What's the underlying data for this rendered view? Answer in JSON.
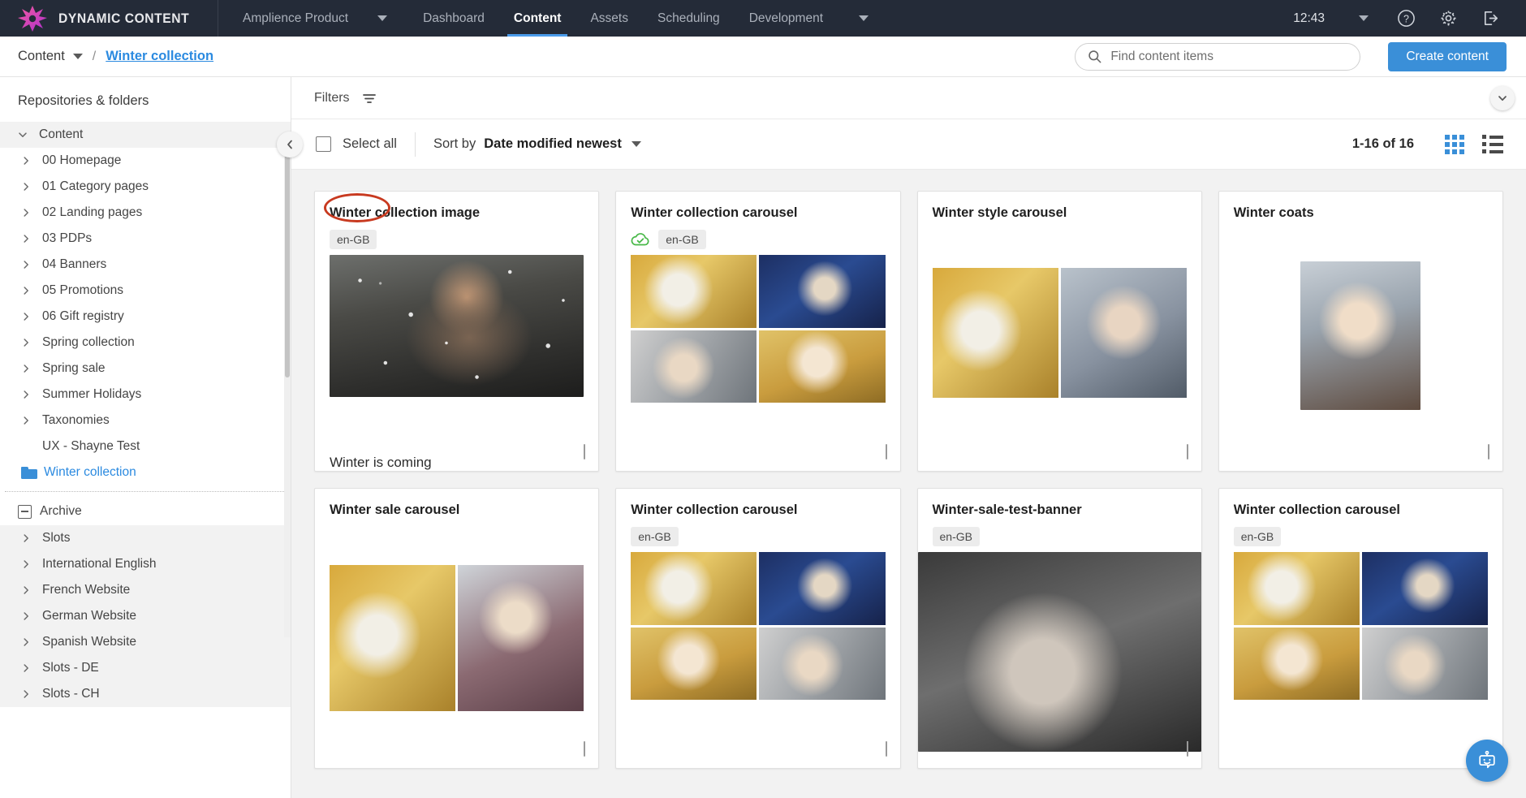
{
  "topnav": {
    "brand": "DYNAMIC CONTENT",
    "product_selector": "Amplience Product",
    "items": [
      {
        "label": "Dashboard",
        "active": false
      },
      {
        "label": "Content",
        "active": true
      },
      {
        "label": "Assets",
        "active": false
      },
      {
        "label": "Scheduling",
        "active": false
      },
      {
        "label": "Development",
        "active": false
      }
    ],
    "clock": "12:43",
    "help_icon": "question-mark-circle-icon",
    "settings_icon": "gear-icon",
    "logout_icon": "sign-out-icon"
  },
  "breadcrumb": {
    "root": "Content",
    "separator": "/",
    "current": "Winter collection"
  },
  "search": {
    "placeholder": "Find content items",
    "value": "",
    "icon": "search-icon"
  },
  "actions": {
    "create_content": "Create content",
    "create_content_color": "#3a8fd8"
  },
  "sidebar": {
    "title": "Repositories & folders",
    "tree": [
      {
        "label": "Content",
        "level": 0,
        "expanded": true,
        "arrow": "chevron-down"
      },
      {
        "label": "00 Homepage",
        "level": 1,
        "arrow": "chevron-right"
      },
      {
        "label": "01 Category pages",
        "level": 1,
        "arrow": "chevron-right"
      },
      {
        "label": "02 Landing pages",
        "level": 1,
        "arrow": "chevron-right"
      },
      {
        "label": "03 PDPs",
        "level": 1,
        "arrow": "chevron-right"
      },
      {
        "label": "04 Banners",
        "level": 1,
        "arrow": "chevron-right"
      },
      {
        "label": "05 Promotions",
        "level": 1,
        "arrow": "chevron-right"
      },
      {
        "label": "06 Gift registry",
        "level": 1,
        "arrow": "chevron-right"
      },
      {
        "label": "Spring collection",
        "level": 1,
        "arrow": "chevron-right"
      },
      {
        "label": "Spring sale",
        "level": 1,
        "arrow": "chevron-right"
      },
      {
        "label": "Summer Holidays",
        "level": 1,
        "arrow": "chevron-right"
      },
      {
        "label": "Taxonomies",
        "level": 1,
        "arrow": "chevron-right"
      },
      {
        "label": "UX - Shayne Test",
        "level": 1,
        "arrow": "none"
      },
      {
        "label": "Winter collection",
        "level": 1,
        "arrow": "none",
        "icon": "folder-icon",
        "selected": true
      }
    ],
    "archive": {
      "label": "Archive",
      "icon": "minus-box-icon"
    },
    "archive_items": [
      {
        "label": "Slots",
        "arrow": "chevron-right"
      },
      {
        "label": "International English",
        "arrow": "chevron-right"
      },
      {
        "label": "French Website",
        "arrow": "chevron-right"
      },
      {
        "label": "German Website",
        "arrow": "chevron-right"
      },
      {
        "label": "Spanish Website",
        "arrow": "chevron-right"
      },
      {
        "label": "Slots - DE",
        "arrow": "chevron-right"
      },
      {
        "label": "Slots - CH",
        "arrow": "chevron-right"
      }
    ]
  },
  "filterbar": {
    "label": "Filters",
    "icon": "filter-icon",
    "expand_icon": "chevron-down-icon"
  },
  "toolbar": {
    "collapse_icon": "chevron-left-icon",
    "select_all": "Select all",
    "select_all_checked": false,
    "sort_by_label": "Sort by",
    "sort_by_value": "Date modified newest",
    "pagination": "1-16 of 16",
    "grid_view_icon": "grid-view-icon",
    "list_view_icon": "list-view-icon",
    "active_view": "grid",
    "grid_active_color": "#3a8fd8"
  },
  "cards": [
    {
      "title": "Winter collection image",
      "locale": "en-GB",
      "published": false,
      "caption": "Winter is coming",
      "thumb": "single",
      "art": [
        "img-snowwoman"
      ],
      "annotated": true,
      "annotation_color": "#c83a20"
    },
    {
      "title": "Winter collection carousel",
      "locale": "en-GB",
      "published": true,
      "publish_icon": "cloud-check-icon",
      "caption": "",
      "thumb": "mosaic2x2",
      "art": [
        "img-goldhat",
        "img-bluenight",
        "img-selfie",
        "img-scarf"
      ],
      "annotated": false
    },
    {
      "title": "Winter style carousel",
      "locale": "",
      "published": false,
      "caption": "",
      "thumb": "mosaic1x2",
      "art": [
        "img-goldhat",
        "img-greycoat"
      ],
      "annotated": false
    },
    {
      "title": "Winter coats",
      "locale": "",
      "published": false,
      "caption": "",
      "thumb": "single",
      "art": [
        "img-redhair"
      ],
      "annotated": false
    },
    {
      "title": "Winter sale carousel",
      "locale": "",
      "published": false,
      "caption": "",
      "thumb": "mosaic1x2",
      "art": [
        "img-goldhat",
        "img-shopper"
      ],
      "annotated": false
    },
    {
      "title": "Winter collection carousel",
      "locale": "en-GB",
      "published": false,
      "caption": "",
      "thumb": "mosaic2x2",
      "art": [
        "img-goldhat",
        "img-bluenight",
        "img-scarf",
        "img-selfie"
      ],
      "annotated": false
    },
    {
      "title": "Winter-sale-test-banner",
      "locale": "en-GB",
      "published": false,
      "caption": "",
      "thumb": "single",
      "art": [
        "img-bwbridge"
      ],
      "annotated": false
    },
    {
      "title": "Winter collection carousel",
      "locale": "en-GB",
      "published": false,
      "caption": "",
      "thumb": "mosaic2x2",
      "art": [
        "img-goldhat",
        "img-bluenight",
        "img-scarf",
        "img-selfie"
      ],
      "annotated": false
    }
  ],
  "chat": {
    "icon": "robot-chat-icon",
    "color": "#3a8fd8"
  }
}
